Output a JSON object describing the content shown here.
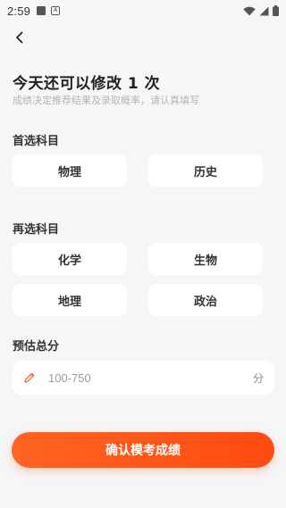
{
  "status_bar": {
    "time": "2:59",
    "icons": [
      "notification-square-icon",
      "a-badge-icon",
      "wifi-icon",
      "signal-icon",
      "battery-icon"
    ]
  },
  "header": {
    "back_icon": "chevron-left-icon"
  },
  "title": "今天还可以修改 1 次",
  "subtitle": "成绩决定推荐结果及录取概率，请认真填写",
  "primary": {
    "label": "首选科目",
    "options": [
      "物理",
      "历史"
    ]
  },
  "secondary": {
    "label": "再选科目",
    "options": [
      "化学",
      "生物",
      "地理",
      "政治"
    ]
  },
  "score": {
    "label": "预估总分",
    "placeholder": "100-750",
    "unit": "分",
    "icon": "pencil-icon"
  },
  "confirm_label": "确认模考成绩",
  "colors": {
    "accent": "#ff5a1e",
    "background": "#f6f6f6",
    "pencil": "#ff6b4a"
  }
}
